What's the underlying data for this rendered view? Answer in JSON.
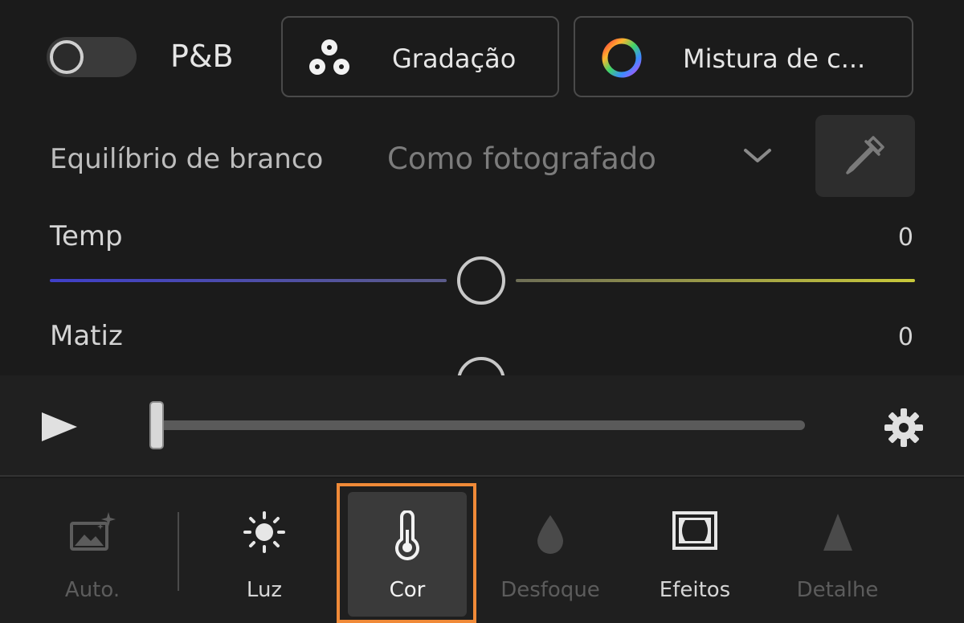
{
  "top": {
    "bw_toggle_label": "P&B",
    "bw_toggle_on": false,
    "buttons": {
      "gradacao": "Gradação",
      "mistura": "Mistura de c..."
    }
  },
  "white_balance": {
    "label": "Equilíbrio de branco",
    "value": "Como fotografado"
  },
  "sliders": {
    "temp": {
      "label": "Temp",
      "value": "0"
    },
    "matiz": {
      "label": "Matiz",
      "value": "0"
    }
  },
  "toolbar": {
    "items": [
      {
        "label": "Auto.",
        "state": "disabled"
      },
      {
        "label": "Luz",
        "state": "enabled"
      },
      {
        "label": "Cor",
        "state": "selected"
      },
      {
        "label": "Desfoque",
        "state": "disabled"
      },
      {
        "label": "Efeitos",
        "state": "enabled"
      },
      {
        "label": "Detalhe",
        "state": "disabled"
      }
    ]
  },
  "colors": {
    "background": "#1a1a1a",
    "selected_tool_bg": "#3a3a3a",
    "highlight_outline": "#f08a38",
    "temp_track_start": "#3f3fc8",
    "temp_track_end": "#c9c93a"
  },
  "icons": {
    "gradacao": "three-circles-icon",
    "mistura": "color-wheel-icon",
    "eyedropper": "eyedropper-icon",
    "play": "play-icon",
    "settings": "gear-icon",
    "auto": "auto-image-sparkle-icon",
    "luz": "sun-icon",
    "cor": "thermometer-icon",
    "desfoque": "drop-icon",
    "efeitos": "vignette-frame-icon",
    "detalhe": "triangle-icon"
  }
}
